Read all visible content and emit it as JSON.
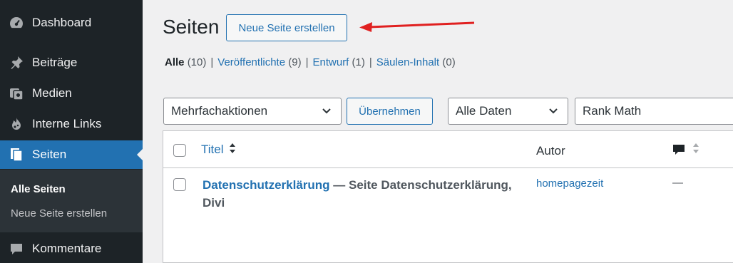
{
  "sidebar": {
    "items": [
      {
        "label": "Dashboard",
        "icon": "dashboard-icon"
      },
      {
        "label": "Beiträge",
        "icon": "pushpin-icon"
      },
      {
        "label": "Medien",
        "icon": "media-icon"
      },
      {
        "label": "Interne Links",
        "icon": "flame-icon"
      },
      {
        "label": "Seiten",
        "icon": "pages-icon"
      },
      {
        "label": "Kommentare",
        "icon": "comment-icon"
      }
    ],
    "submenu": [
      "Alle Seiten",
      "Neue Seite erstellen"
    ]
  },
  "header": {
    "title": "Seiten",
    "new_button": "Neue Seite erstellen"
  },
  "filters": {
    "all_label": "Alle",
    "all_count": "(10)",
    "published_label": "Veröffentlichte",
    "published_count": "(9)",
    "draft_label": "Entwurf",
    "draft_count": "(1)",
    "column_label": "Säulen-Inhalt",
    "column_count": "(0)",
    "separator": "|"
  },
  "bulk": {
    "select_value": "Mehrfachaktionen",
    "apply_button": "Übernehmen",
    "dates_value": "Alle Daten",
    "rankmath_value": "Rank Math"
  },
  "table": {
    "columns": {
      "title": "Titel",
      "author": "Autor"
    },
    "rows": [
      {
        "title": "Datenschutzerklärung",
        "state": " — Seite Datenschutzerklärung, Divi",
        "author": "homepagezeit",
        "comments": "—"
      }
    ]
  },
  "colors": {
    "accent": "#2271b1",
    "sidebar": "#1d2327",
    "arrow": "#e02020"
  }
}
